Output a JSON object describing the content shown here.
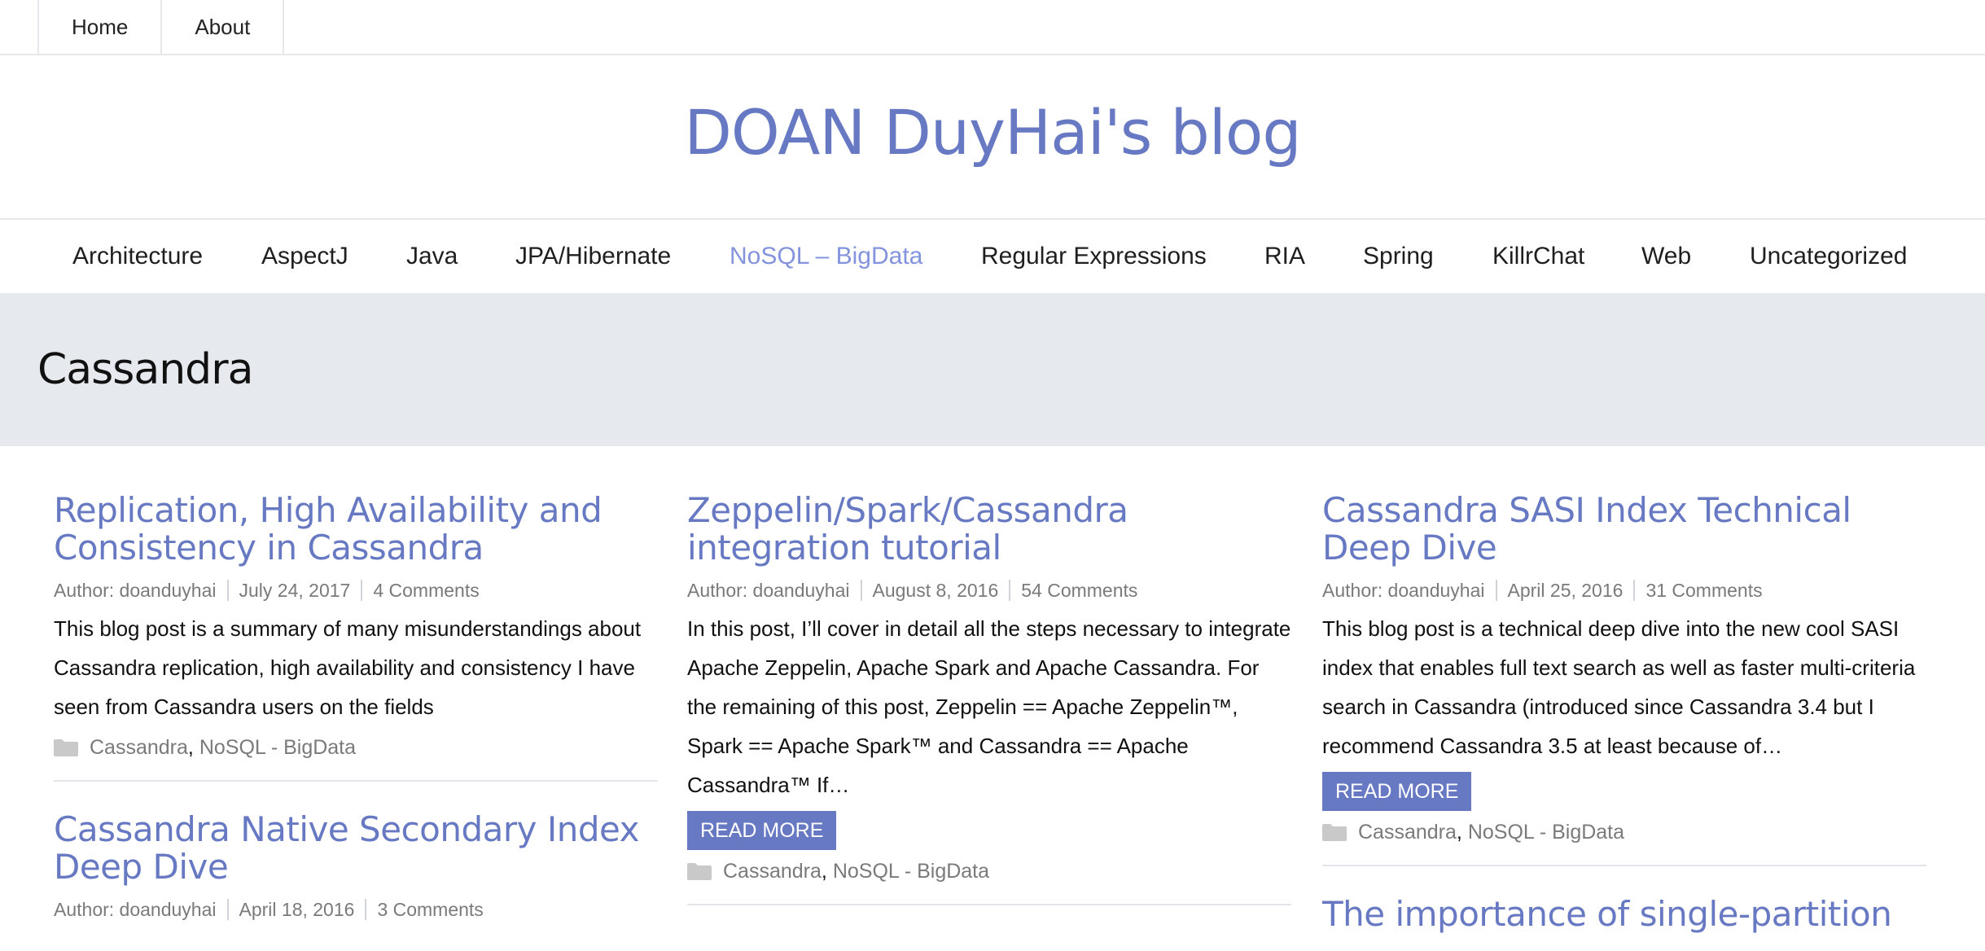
{
  "top_nav": {
    "items": [
      "Home",
      "About"
    ]
  },
  "site": {
    "title": "DOAN DuyHai's blog"
  },
  "category_nav": {
    "items": [
      "Architecture",
      "AspectJ",
      "Java",
      "JPA/Hibernate",
      "NoSQL – BigData",
      "Regular Expressions",
      "RIA",
      "Spring",
      "KillrChat",
      "Web",
      "Uncategorized"
    ],
    "active": "NoSQL – BigData"
  },
  "archive": {
    "title": "Cassandra"
  },
  "colors": {
    "accent": "#6779c2",
    "active_nav": "#8393dd",
    "band": "#e6e9ee"
  },
  "posts": {
    "col1": [
      {
        "title": "Replication, High Availability and Consistency in Cassandra",
        "author": "Author: doanduyhai",
        "date": "July 24, 2017",
        "comments": "4 Comments",
        "excerpt": "This blog post is a summary of many misunderstandings about Cassandra replication, high availability and consistency I have seen from Cassandra users on the fields",
        "cat1": "Cassandra",
        "cat_sep": ", ",
        "cat2": "NoSQL - BigData"
      },
      {
        "title": "Cassandra Native Secondary Index Deep Dive",
        "author": "Author: doanduyhai",
        "date": "April 18, 2016",
        "comments": "3 Comments"
      }
    ],
    "col2": [
      {
        "title": "Zeppelin/Spark/Cassandra integration tutorial",
        "author": "Author: doanduyhai",
        "date": "August 8, 2016",
        "comments": "54 Comments",
        "excerpt": "In this post, I’ll cover in detail all the steps necessary to integrate Apache Zeppelin, Apache Spark and Apache Cassandra. For the remaining of this post, Zeppelin == Apache Zeppelin™, Spark == Apache Spark™ and Cassandra == Apache Cassandra™ If…",
        "read_more": "READ MORE",
        "cat1": "Cassandra",
        "cat_sep": ", ",
        "cat2": "NoSQL - BigData"
      }
    ],
    "col3": [
      {
        "title": "Cassandra SASI Index Technical Deep Dive",
        "author": "Author: doanduyhai",
        "date": "April 25, 2016",
        "comments": "31 Comments",
        "excerpt": "This blog post is a technical deep dive into the new cool SASI index that enables full text search as well as faster multi-criteria search in Cassandra (introduced since Cassandra 3.4 but I recommend Cassandra 3.5 at least because of…",
        "read_more": "READ MORE",
        "cat1": "Cassandra",
        "cat_sep": ", ",
        "cat2": "NoSQL - BigData"
      },
      {
        "title": "The importance of single-partition"
      }
    ]
  },
  "icons": {
    "category": "folder-icon"
  }
}
